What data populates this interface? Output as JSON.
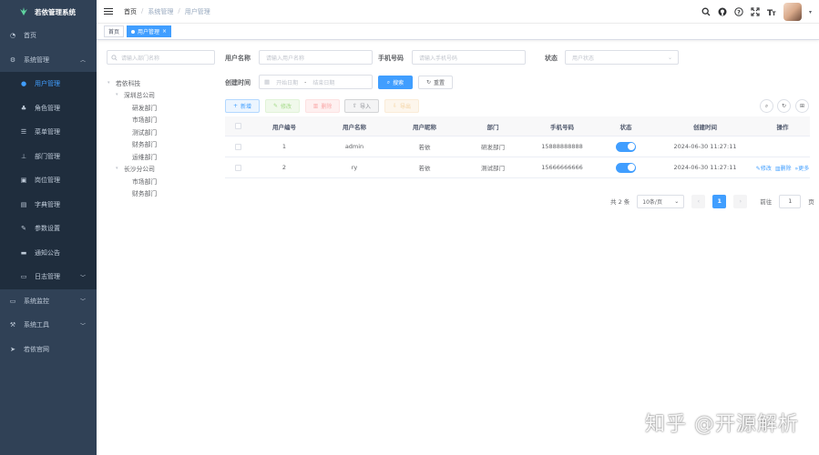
{
  "app": {
    "title": "若依管理系统"
  },
  "sidebar": {
    "items": [
      {
        "label": "首页",
        "icon": "dashboard-icon",
        "glyph": "◔"
      },
      {
        "label": "系统管理",
        "icon": "gear-icon",
        "glyph": "⚙",
        "expanded": true
      },
      {
        "label": "用户管理",
        "icon": "user-icon",
        "glyph": "●",
        "active": true
      },
      {
        "label": "角色管理",
        "icon": "peoples-icon",
        "glyph": "♣"
      },
      {
        "label": "菜单管理",
        "icon": "tree-table-icon",
        "glyph": "☰"
      },
      {
        "label": "部门管理",
        "icon": "tree-icon",
        "glyph": "⊥"
      },
      {
        "label": "岗位管理",
        "icon": "post-icon",
        "glyph": "▣"
      },
      {
        "label": "字典管理",
        "icon": "dict-icon",
        "glyph": "▤"
      },
      {
        "label": "参数设置",
        "icon": "edit-icon",
        "glyph": "✎"
      },
      {
        "label": "通知公告",
        "icon": "message-icon",
        "glyph": "▬"
      },
      {
        "label": "日志管理",
        "icon": "log-icon",
        "glyph": "▭"
      },
      {
        "label": "系统监控",
        "icon": "monitor-icon",
        "glyph": "▭"
      },
      {
        "label": "系统工具",
        "icon": "tool-icon",
        "glyph": "⚒"
      },
      {
        "label": "若依官网",
        "icon": "guide-icon",
        "glyph": "➤"
      }
    ]
  },
  "breadcrumb": {
    "home": "首页",
    "level1": "系统管理",
    "level2": "用户管理",
    "sep": "/"
  },
  "tags": {
    "home": "首页",
    "current": "用户管理",
    "close": "×"
  },
  "dept": {
    "search_placeholder": "请输入部门名称",
    "tree": [
      {
        "label": "若依科技",
        "level": 0,
        "toggle": "▾"
      },
      {
        "label": "深圳总公司",
        "level": 1,
        "toggle": "▾"
      },
      {
        "label": "研发部门",
        "level": 2,
        "toggle": ""
      },
      {
        "label": "市场部门",
        "level": 2,
        "toggle": ""
      },
      {
        "label": "测试部门",
        "level": 2,
        "toggle": ""
      },
      {
        "label": "财务部门",
        "level": 2,
        "toggle": ""
      },
      {
        "label": "运维部门",
        "level": 2,
        "toggle": ""
      },
      {
        "label": "长沙分公司",
        "level": 1,
        "toggle": "▾"
      },
      {
        "label": "市场部门",
        "level": 2,
        "toggle": ""
      },
      {
        "label": "财务部门",
        "level": 2,
        "toggle": ""
      }
    ]
  },
  "query": {
    "username_label": "用户名称",
    "username_placeholder": "请输入用户名称",
    "phone_label": "手机号码",
    "phone_placeholder": "请输入手机号码",
    "status_label": "状态",
    "status_placeholder": "用户状态",
    "date_label": "创建时间",
    "date_start": "开始日期",
    "date_sep": "-",
    "date_end": "结束日期",
    "search_btn": "搜索",
    "reset_btn": "重置"
  },
  "toolbar": {
    "add": "新增",
    "edit": "修改",
    "delete": "删除",
    "import": "导入",
    "export": "导出"
  },
  "table": {
    "headers": [
      "用户编号",
      "用户名称",
      "用户昵称",
      "部门",
      "手机号码",
      "状态",
      "创建时间",
      "操作"
    ],
    "rows": [
      {
        "id": "1",
        "username": "admin",
        "nickname": "若依",
        "dept": "研发部门",
        "phone": "15888888888",
        "status_on": true,
        "created": "2024-06-30 11:27:11",
        "ops": []
      },
      {
        "id": "2",
        "username": "ry",
        "nickname": "若依",
        "dept": "测试部门",
        "phone": "15666666666",
        "status_on": true,
        "created": "2024-06-30 11:27:11",
        "ops": [
          "修改",
          "删除",
          "更多"
        ]
      }
    ]
  },
  "pagination": {
    "total": "共 2 条",
    "page_size": "10条/页",
    "current": "1",
    "goto": "前往",
    "goto_value": "1",
    "page_unit": "页"
  },
  "watermark": "知乎 @开源解析",
  "colors": {
    "sidebar_bg": "#304156",
    "primary": "#409eff"
  }
}
